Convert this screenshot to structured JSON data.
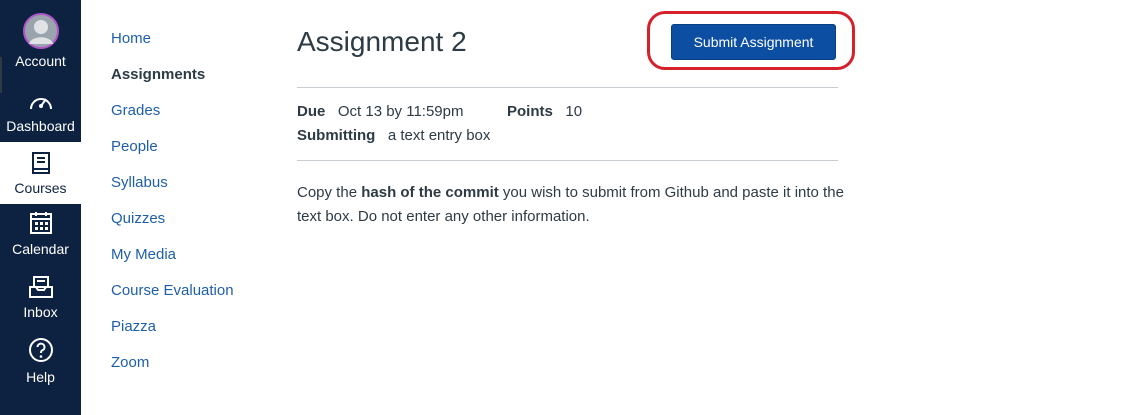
{
  "global_nav": {
    "account": "Account",
    "dashboard": "Dashboard",
    "courses": "Courses",
    "calendar": "Calendar",
    "inbox": "Inbox",
    "help": "Help"
  },
  "course_nav": [
    "Home",
    "Assignments",
    "Grades",
    "People",
    "Syllabus",
    "Quizzes",
    "My Media",
    "Course Evaluation",
    "Piazza",
    "Zoom"
  ],
  "course_nav_active": "Assignments",
  "assignment": {
    "title": "Assignment 2",
    "submit_label": "Submit Assignment",
    "due_label": "Due",
    "due_value": "Oct 13 by 11:59pm",
    "points_label": "Points",
    "points_value": "10",
    "submitting_label": "Submitting",
    "submitting_value": "a text entry box",
    "description_pre": "Copy the ",
    "description_bold": "hash of the commit",
    "description_post": " you wish to submit from Github and paste it into the text box. Do not enter any other information."
  },
  "colors": {
    "nav_bg": "#0d2240",
    "link": "#1f5fa8",
    "button": "#0b4ea2",
    "highlight": "#d6202a"
  }
}
